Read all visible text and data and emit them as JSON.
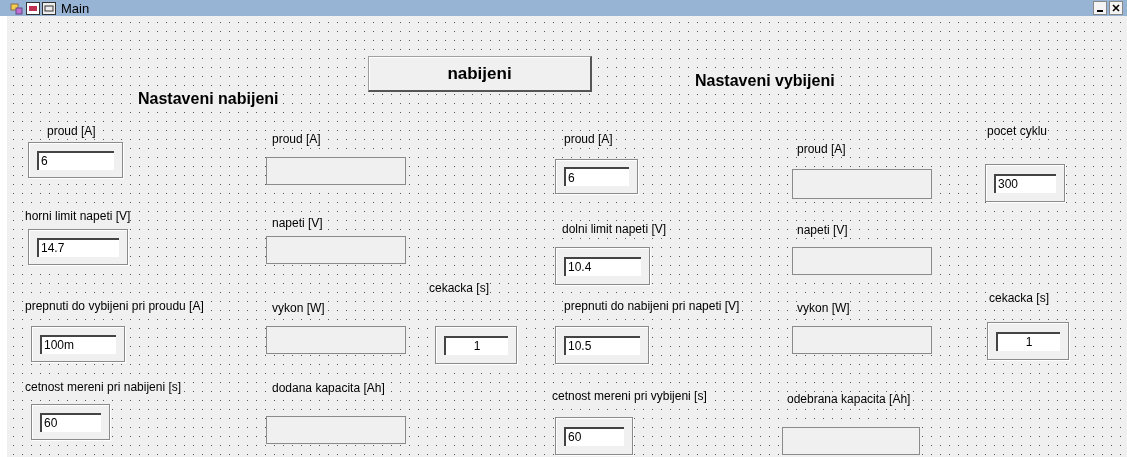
{
  "window": {
    "title": "Main"
  },
  "headings": [
    "Nastaveni nabijeni",
    "Nastaveni vybijeni"
  ],
  "button": {
    "label": "nabijeni"
  },
  "controls": [
    {
      "kind": "input",
      "label": "proud [A]",
      "value": "6"
    },
    {
      "kind": "input",
      "label": "horni limit napeti [V]",
      "value": "14.7"
    },
    {
      "kind": "input",
      "label": "prepnuti do vybijeni pri proudu [A]",
      "value": "100m"
    },
    {
      "kind": "input",
      "label": "cetnost mereni pri nabijeni [s]",
      "value": "60"
    },
    {
      "kind": "indicator",
      "label": "proud [A]"
    },
    {
      "kind": "indicator",
      "label": "napeti [V]"
    },
    {
      "kind": "indicator",
      "label": "vykon [W]"
    },
    {
      "kind": "indicator",
      "label": "dodana kapacita [Ah]"
    },
    {
      "kind": "centered-input",
      "label": "cekacka [s]",
      "value": "1"
    },
    {
      "kind": "input",
      "label": "proud [A]",
      "value": "6"
    },
    {
      "kind": "input",
      "label": "dolni limit napeti [V]",
      "value": "10.4"
    },
    {
      "kind": "input",
      "label": "prepnuti do nabijeni pri napeti [V]",
      "value": "10.5"
    },
    {
      "kind": "input",
      "label": "cetnost mereni pri vybijeni [s]",
      "value": "60"
    },
    {
      "kind": "indicator",
      "label": "proud [A]"
    },
    {
      "kind": "indicator",
      "label": "napeti [V]"
    },
    {
      "kind": "indicator",
      "label": "vykon [W]"
    },
    {
      "kind": "indicator",
      "label": "odebrana kapacita [Ah]"
    },
    {
      "kind": "input",
      "label": "pocet cyklu",
      "value": "300"
    },
    {
      "kind": "centered-input",
      "label": "cekacka [s]",
      "value": "1"
    }
  ]
}
